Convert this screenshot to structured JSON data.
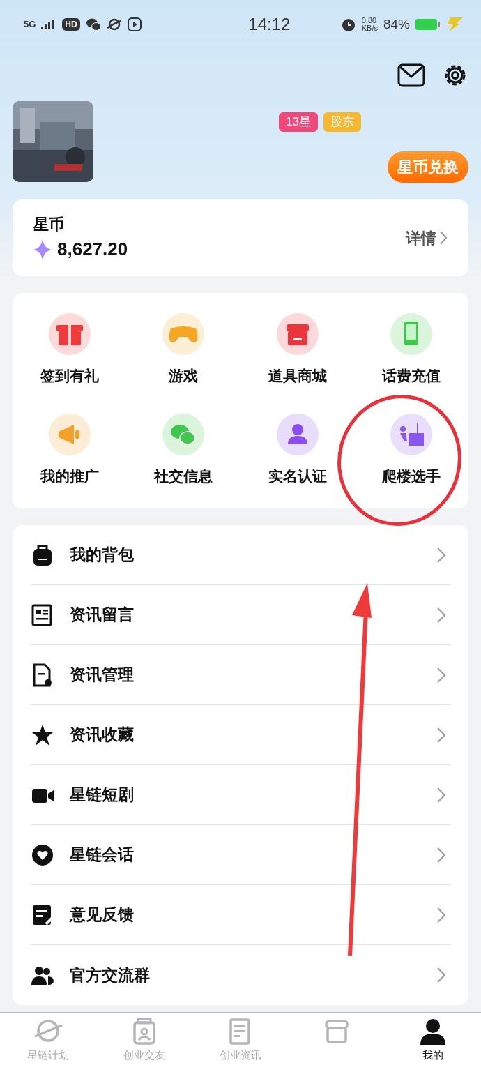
{
  "status_bar": {
    "network": "5G",
    "hd": "HD",
    "time": "14:12",
    "speed_value": "0.80",
    "speed_unit": "KB/s",
    "battery": "84%"
  },
  "profile": {
    "badges": [
      {
        "text": "13星",
        "color": "#f0487a"
      },
      {
        "text": "股东",
        "color": "#f5b82e"
      }
    ],
    "exchange_button": "星币兑换"
  },
  "coins": {
    "label": "星币",
    "amount": "8,627.20",
    "details": "详情"
  },
  "features": [
    {
      "label": "签到有礼",
      "kind": "gift",
      "color": "#ee3b3b"
    },
    {
      "label": "游戏",
      "kind": "gamepad",
      "color": "#f5a623"
    },
    {
      "label": "道具商城",
      "kind": "store",
      "color": "#e8363c"
    },
    {
      "label": "话费充值",
      "kind": "phone",
      "color": "#3ec94a"
    },
    {
      "label": "我的推广",
      "kind": "megaphone",
      "color": "#f5a02a"
    },
    {
      "label": "社交信息",
      "kind": "chat",
      "color": "#3fc84b"
    },
    {
      "label": "实名认证",
      "kind": "person",
      "color": "#8b4df0"
    },
    {
      "label": "爬楼选手",
      "kind": "climber",
      "color": "#8a56f0"
    }
  ],
  "menu": [
    {
      "label": "我的背包",
      "kind": "backpack"
    },
    {
      "label": "资讯留言",
      "kind": "news"
    },
    {
      "label": "资讯管理",
      "kind": "doc-gear"
    },
    {
      "label": "资讯收藏",
      "kind": "star"
    },
    {
      "label": "星链短剧",
      "kind": "video"
    },
    {
      "label": "星链会话",
      "kind": "heart-chat"
    },
    {
      "label": "意见反馈",
      "kind": "feedback"
    },
    {
      "label": "官方交流群",
      "kind": "group"
    }
  ],
  "tab_bar": [
    {
      "label": "星链计划",
      "kind": "planet",
      "selected": false
    },
    {
      "label": "创业交友",
      "kind": "idcard",
      "selected": false
    },
    {
      "label": "创业资讯",
      "kind": "doc",
      "selected": false
    },
    {
      "kind": "shop",
      "selected": false
    },
    {
      "label": "我的",
      "kind": "user",
      "selected": true
    }
  ]
}
